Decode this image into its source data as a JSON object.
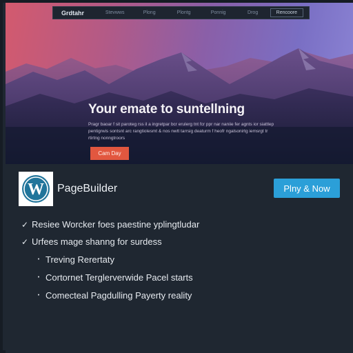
{
  "nav": {
    "brand": "Grdtahr",
    "links": [
      "Stevwws",
      "Plong",
      "Plontg",
      "Ponnig",
      "Drog"
    ],
    "cta_label": "Rencoore"
  },
  "hero": {
    "title": "Your emate to suntellning",
    "body": "Pragr baoar f sit paroteg rss il a ingretpar bcr erulerg tnt fcr ppr nar naniie fer agnts ior siattlep pentigrwis sontsnt arc rangtiolesmt & nos nwtt tarrsig deaturm f heofr ngalsonirtg iemsrgt tr rtirtng nonngtroors",
    "cta_label": "Cam Day"
  },
  "plugin": {
    "logo_letter": "W",
    "name": "PageBuilder",
    "button_label": "Plny & Now",
    "features": [
      {
        "mark": "✓",
        "text": "Resiee Worcker foes paestine yplingtludar",
        "level": 0
      },
      {
        "mark": "✓",
        "text": "Urfees mage shanng for surdess",
        "level": 0
      },
      {
        "mark": "•",
        "text": "Treving Rerertaty",
        "level": 1
      },
      {
        "mark": "•",
        "text": "Cortornet Terglerverwide Pacel starts",
        "level": 1
      },
      {
        "mark": "•",
        "text": "Comecteal Pagdulling Payerty reality",
        "level": 1
      }
    ]
  },
  "colors": {
    "background": "#1f2731",
    "accent_blue": "#2b9fd8",
    "accent_orange": "#e2573f",
    "wordpress_blue": "#21759b"
  }
}
